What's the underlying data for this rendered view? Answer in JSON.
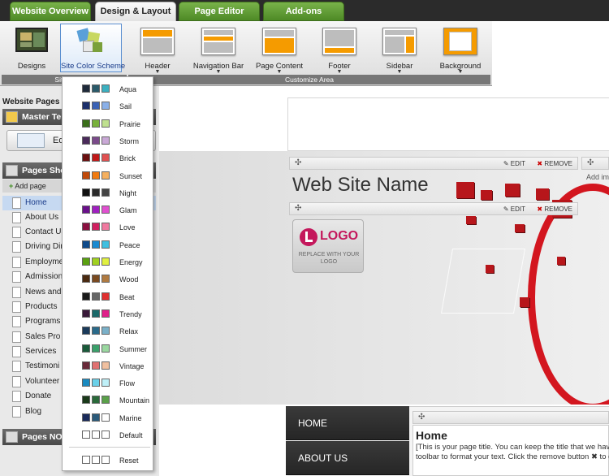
{
  "tabs": [
    {
      "label": "Website Overview"
    },
    {
      "label": "Design & Layout"
    },
    {
      "label": "Page Editor"
    },
    {
      "label": "Add-ons"
    }
  ],
  "ribbon": {
    "items": [
      {
        "label": "Designs"
      },
      {
        "label": "Site Color Scheme"
      },
      {
        "label": "Header"
      },
      {
        "label": "Navigation Bar"
      },
      {
        "label": "Page Content"
      },
      {
        "label": "Footer"
      },
      {
        "label": "Sidebar"
      },
      {
        "label": "Background"
      }
    ],
    "group_left": "Site D",
    "group_right": "Customize Area"
  },
  "left_panel": {
    "title": "Website Pages",
    "master": {
      "header": "Master Te",
      "button": "Ed"
    },
    "pages_shown": {
      "header": "Pages Sho",
      "add": "Add page"
    },
    "pages": [
      "Home",
      "About Us",
      "Contact Us",
      "Driving Dir",
      "Employme",
      "Admission",
      "News and",
      "Products",
      "Programs",
      "Sales Pro",
      "Services",
      "Testimoni",
      "Volunteer",
      "Donate",
      "Blog"
    ],
    "pages_not": {
      "header": "Pages NOT"
    }
  },
  "color_schemes": [
    {
      "name": "Aqua",
      "colors": [
        "#1f2a3a",
        "#2a5a6a",
        "#3bb0c0"
      ]
    },
    {
      "name": "Sail",
      "colors": [
        "#1b2f6b",
        "#3a62b5",
        "#8ab0e8"
      ]
    },
    {
      "name": "Prairie",
      "colors": [
        "#3a6e1a",
        "#77b03a",
        "#bfe08f"
      ]
    },
    {
      "name": "Storm",
      "colors": [
        "#4a2a5a",
        "#7a4a8a",
        "#c9a8d6"
      ]
    },
    {
      "name": "Brick",
      "colors": [
        "#6a0f0f",
        "#c01818",
        "#e05050"
      ]
    },
    {
      "name": "Sunset",
      "colors": [
        "#c04a0a",
        "#f07a10",
        "#f5b060"
      ]
    },
    {
      "name": "Night",
      "colors": [
        "#111111",
        "#2a2a2a",
        "#444444"
      ]
    },
    {
      "name": "Glam",
      "colors": [
        "#6a108a",
        "#a020c0",
        "#e050d0"
      ]
    },
    {
      "name": "Love",
      "colors": [
        "#8a1040",
        "#d02060",
        "#f07aa0"
      ]
    },
    {
      "name": "Peace",
      "colors": [
        "#0e4a8a",
        "#1a8ad0",
        "#40c0e0"
      ]
    },
    {
      "name": "Energy",
      "colors": [
        "#5aa010",
        "#a0d020",
        "#e0f040"
      ]
    },
    {
      "name": "Wood",
      "colors": [
        "#4a2a10",
        "#7a4a20",
        "#b07a40"
      ]
    },
    {
      "name": "Beat",
      "colors": [
        "#1a1a1a",
        "#666666",
        "#e03030"
      ]
    },
    {
      "name": "Trendy",
      "colors": [
        "#3a1a3a",
        "#1a6a6a",
        "#e0208a"
      ]
    },
    {
      "name": "Relax",
      "colors": [
        "#1a3a5a",
        "#2a6a8a",
        "#7ab0c8"
      ]
    },
    {
      "name": "Summer",
      "colors": [
        "#1a5a3a",
        "#3aa06a",
        "#9ad8a0"
      ]
    },
    {
      "name": "Vintage",
      "colors": [
        "#6a2a3a",
        "#e07070",
        "#f0c0a0"
      ]
    },
    {
      "name": "Flow",
      "colors": [
        "#1a8ac0",
        "#6ad0e8",
        "#bff0f8"
      ]
    },
    {
      "name": "Mountain",
      "colors": [
        "#1a3a1a",
        "#2a6a3a",
        "#5aa04a"
      ]
    },
    {
      "name": "Marine",
      "colors": [
        "#1a2a5a",
        "#2a5a7a",
        "#ffffff"
      ]
    },
    {
      "name": "Default",
      "colors": [
        "#ffffff",
        "#ffffff",
        "#ffffff"
      ]
    }
  ],
  "reset_label": "Reset",
  "preview": {
    "site_name": "Web Site Name",
    "edit": "EDIT",
    "remove": "REMOVE",
    "add_label": "Add im",
    "logo_text": "LOGO",
    "logo_sub": "REPLACE WITH YOUR LOGO",
    "nav": [
      "HOME",
      "ABOUT US"
    ],
    "page_title": "Home",
    "page_note_1": "[This is your page title. You can keep the title that we have",
    "page_note_2": "toolbar to format your text. Click the remove button ✖ to de"
  }
}
